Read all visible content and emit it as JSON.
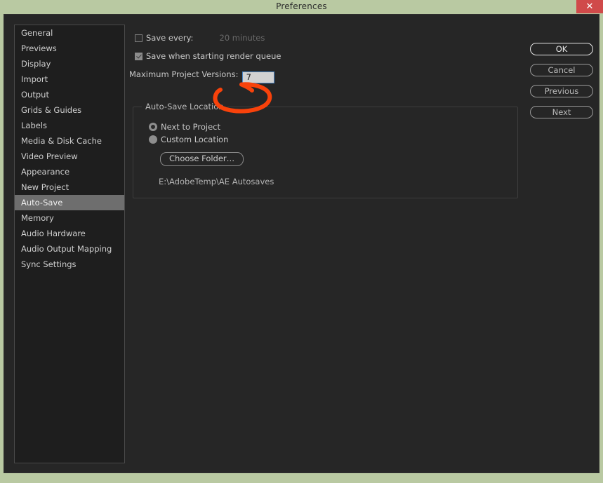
{
  "window": {
    "title": "Preferences",
    "close_icon": "close-x-icon",
    "close_label": "✕",
    "titlebar_color": "#b9c9a2",
    "body_color": "#262626",
    "close_button_color": "#d04a4a"
  },
  "sidebar": {
    "items": [
      {
        "label": "General",
        "selected": false
      },
      {
        "label": "Previews",
        "selected": false
      },
      {
        "label": "Display",
        "selected": false
      },
      {
        "label": "Import",
        "selected": false
      },
      {
        "label": "Output",
        "selected": false
      },
      {
        "label": "Grids & Guides",
        "selected": false
      },
      {
        "label": "Labels",
        "selected": false
      },
      {
        "label": "Media & Disk Cache",
        "selected": false
      },
      {
        "label": "Video Preview",
        "selected": false
      },
      {
        "label": "Appearance",
        "selected": false
      },
      {
        "label": "New Project",
        "selected": false
      },
      {
        "label": "Auto-Save",
        "selected": true
      },
      {
        "label": "Memory",
        "selected": false
      },
      {
        "label": "Audio Hardware",
        "selected": false
      },
      {
        "label": "Audio Output Mapping",
        "selected": false
      },
      {
        "label": "Sync Settings",
        "selected": false
      }
    ],
    "selected_color": "#6e6e6e"
  },
  "main": {
    "save_every": {
      "label": "Save every:",
      "checked": false,
      "value_label": "20 minutes"
    },
    "save_render_queue": {
      "label": "Save when starting render queue",
      "checked": true
    },
    "max_versions": {
      "label": "Maximum Project Versions:",
      "value": "7",
      "field_border_color": "#4b86c6",
      "field_bg_color": "#d2d2d2"
    },
    "autosave_location": {
      "group_label": "Auto-Save Location",
      "options": [
        {
          "label": "Next to Project",
          "state": "ring"
        },
        {
          "label": "Custom Location",
          "state": "solid"
        }
      ],
      "choose_folder_label": "Choose Folder…",
      "path": "E:\\AdobeTemp\\AE Autosaves"
    }
  },
  "buttons": [
    {
      "label": "OK",
      "primary": true
    },
    {
      "label": "Cancel",
      "primary": false
    },
    {
      "label": "Previous",
      "primary": false
    },
    {
      "label": "Next",
      "primary": false
    }
  ],
  "annotation": {
    "shape": "hand-drawn-red-circle",
    "color": "#f8420b",
    "target": "Maximum Project Versions value field"
  }
}
